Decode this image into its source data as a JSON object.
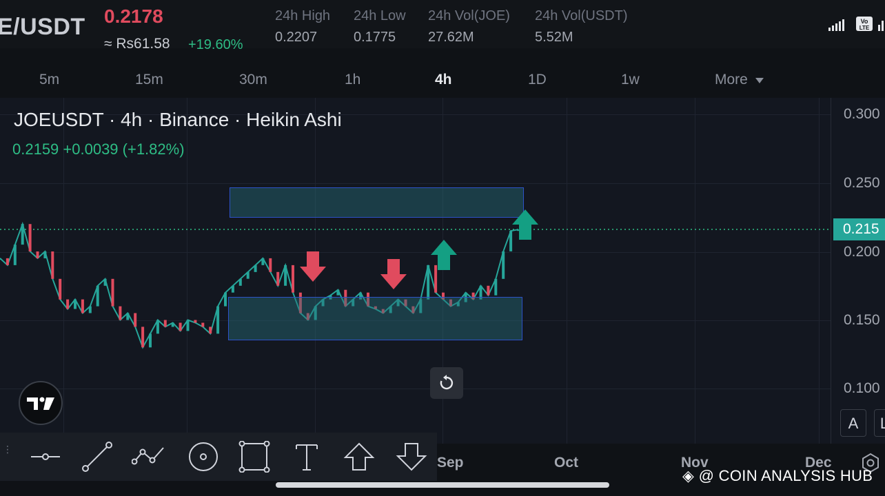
{
  "header": {
    "pair": "E/USDT",
    "last_price": "0.2178",
    "fiat_price": "≈ Rs61.58",
    "change_pct": "+19.60%",
    "stats": [
      {
        "label": "24h High",
        "value": "0.2207"
      },
      {
        "label": "24h Low",
        "value": "0.1775"
      },
      {
        "label": "24h Vol(JOE)",
        "value": "27.62M"
      },
      {
        "label": "24h Vol(USDT)",
        "value": "5.52M"
      }
    ],
    "status_icons": [
      "signal-icon",
      "volte-icon",
      "wifi-icon"
    ],
    "volte_text": "Vo LTE"
  },
  "timeframes": {
    "items": [
      "5m",
      "15m",
      "30m",
      "1h",
      "4h",
      "1D",
      "1w",
      "More"
    ],
    "active": "4h"
  },
  "chart": {
    "title": "JOEUSDT · 4h · Binance · Heikin Ashi",
    "ohlc_line": "0.2159  +0.0039 (+1.82%)",
    "current_price_tag": "0.215",
    "reset_icon": "reset-icon",
    "logo_icon": "tradingview-logo-icon",
    "auto_scale_label": "A",
    "log_label": "L"
  },
  "chart_data": {
    "type": "line",
    "title": "JOEUSDT · 4h · Binance · Heikin Ashi",
    "xlabel": "",
    "ylabel": "",
    "x_tick_labels": [
      "Sep",
      "Oct",
      "Nov",
      "Dec"
    ],
    "y_tick_labels": [
      "0.300",
      "0.250",
      "0.200",
      "0.150",
      "0.100"
    ],
    "ylim": [
      0.08,
      0.31
    ],
    "grid": true,
    "series": [
      {
        "values": [
          0.195,
          0.19,
          0.205,
          0.22,
          0.2,
          0.195,
          0.2,
          0.18,
          0.165,
          0.158,
          0.165,
          0.155,
          0.16,
          0.175,
          0.18,
          0.16,
          0.15,
          0.155,
          0.145,
          0.13,
          0.14,
          0.15,
          0.145,
          0.148,
          0.142,
          0.15,
          0.148,
          0.145,
          0.14,
          0.16,
          0.17,
          0.175,
          0.18,
          0.185,
          0.19,
          0.195,
          0.185,
          0.175,
          0.19,
          0.17,
          0.155,
          0.15,
          0.16,
          0.165,
          0.168,
          0.172,
          0.16,
          0.165,
          0.17,
          0.16,
          0.158,
          0.155,
          0.16,
          0.165,
          0.16,
          0.155,
          0.165,
          0.19,
          0.17,
          0.165,
          0.16,
          0.163,
          0.17,
          0.165,
          0.175,
          0.168,
          0.18,
          0.2,
          0.215,
          0.216
        ]
      }
    ],
    "annotations": {
      "current_price": 0.215,
      "resistance_zone": [
        0.225,
        0.246
      ],
      "support_zone": [
        0.138,
        0.168
      ],
      "down_arrows": 2,
      "up_arrows": 2
    }
  },
  "drawing_tools": [
    {
      "name": "horizontal-line-icon"
    },
    {
      "name": "trend-line-icon"
    },
    {
      "name": "path-icon"
    },
    {
      "name": "circle-tool-icon"
    },
    {
      "name": "rectangle-tool-icon"
    },
    {
      "name": "text-tool-icon"
    },
    {
      "name": "arrow-up-tool-icon"
    },
    {
      "name": "arrow-down-tool-icon"
    }
  ],
  "watermark": "◈ @ COIN ANALYSIS HUB",
  "colors": {
    "up": "#26a69a",
    "down": "#e04b5e",
    "zone_border": "#2d52c8",
    "background": "#131720"
  }
}
